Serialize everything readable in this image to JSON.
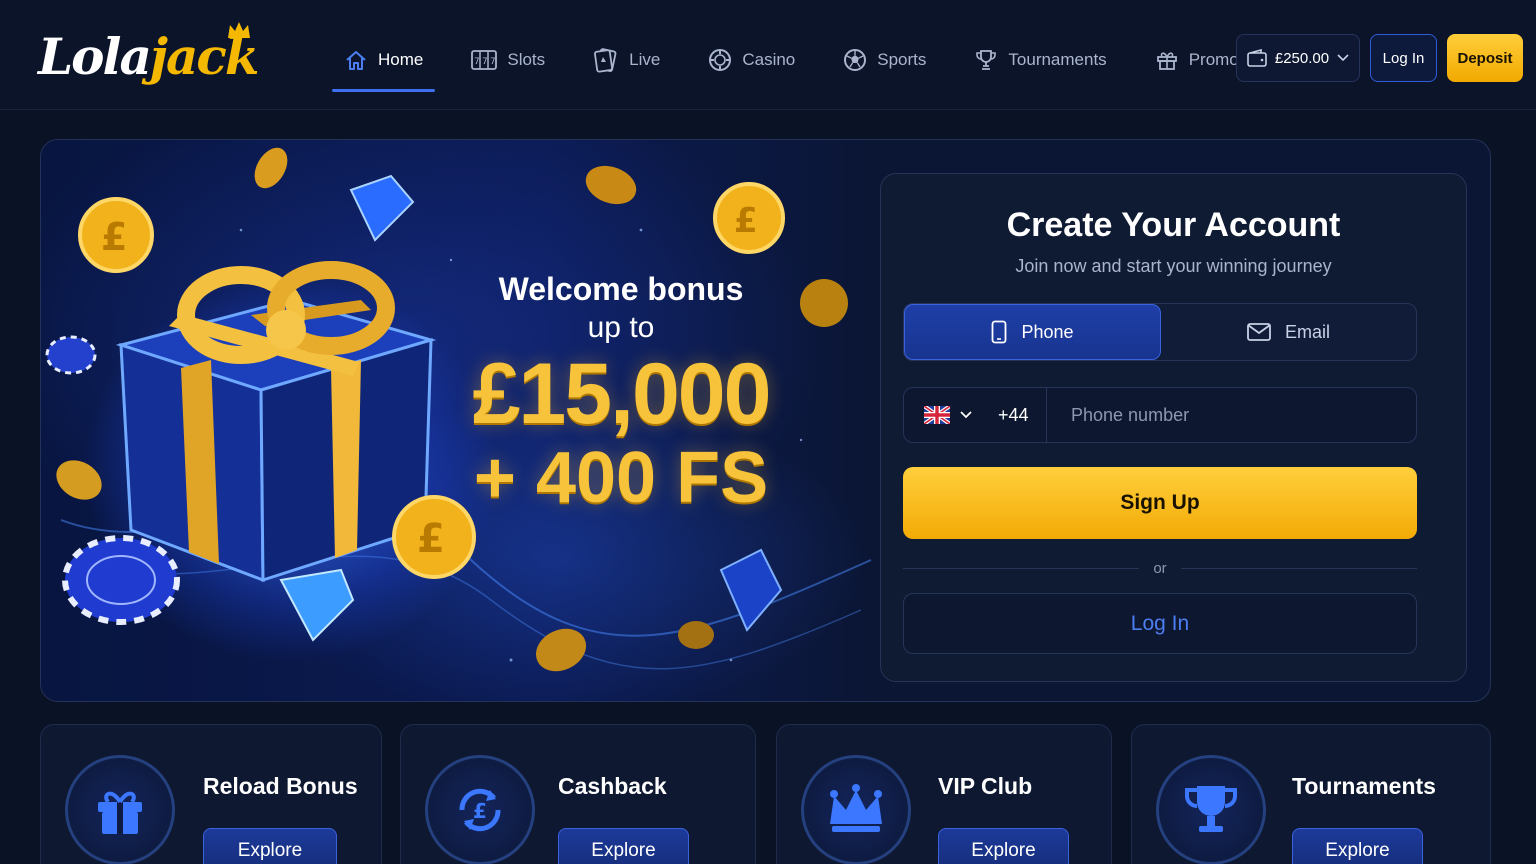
{
  "brand": {
    "name_part1": "Lola",
    "name_part2": "jack"
  },
  "nav": {
    "items": [
      {
        "label": "Home",
        "icon": "home-icon",
        "active": true
      },
      {
        "label": "Slots",
        "icon": "slots-icon"
      },
      {
        "label": "Live",
        "icon": "live-cards-icon"
      },
      {
        "label": "Casino",
        "icon": "casino-chip-icon"
      },
      {
        "label": "Sports",
        "icon": "soccer-ball-icon"
      },
      {
        "label": "Tournaments",
        "icon": "trophy-icon"
      },
      {
        "label": "Promotions",
        "icon": "gift-icon"
      }
    ]
  },
  "header": {
    "balance": "£250.00",
    "login_label": "Log In",
    "deposit_label": "Deposit"
  },
  "hero": {
    "line1": "Welcome bonus",
    "line2": "up to",
    "amount": "£15,000",
    "free_spins": "+ 400 FS"
  },
  "signup_form": {
    "title": "Create Your Account",
    "subtitle": "Join now and start your winning journey",
    "tabs": [
      {
        "label": "Phone",
        "icon": "phone-icon",
        "active": true
      },
      {
        "label": "Email",
        "icon": "mail-icon",
        "active": false
      }
    ],
    "country_flag": "uk-flag-icon",
    "country_code": "+44",
    "phone_placeholder": "Phone number",
    "signup_label": "Sign Up",
    "divider_text": "or",
    "login_label": "Log In"
  },
  "features": [
    {
      "title": "Reload Bonus",
      "icon": "gift-icon",
      "button": "Explore"
    },
    {
      "title": "Cashback",
      "icon": "cashback-icon",
      "button": "Explore"
    },
    {
      "title": "VIP Club",
      "icon": "crown-icon",
      "button": "Explore"
    },
    {
      "title": "Tournaments",
      "icon": "trophy-icon",
      "button": "Explore"
    }
  ],
  "colors": {
    "background": "#0a1326",
    "accent_gold": "#f7c33a",
    "accent_blue": "#3d6ff0",
    "link_blue": "#4d7df2"
  }
}
